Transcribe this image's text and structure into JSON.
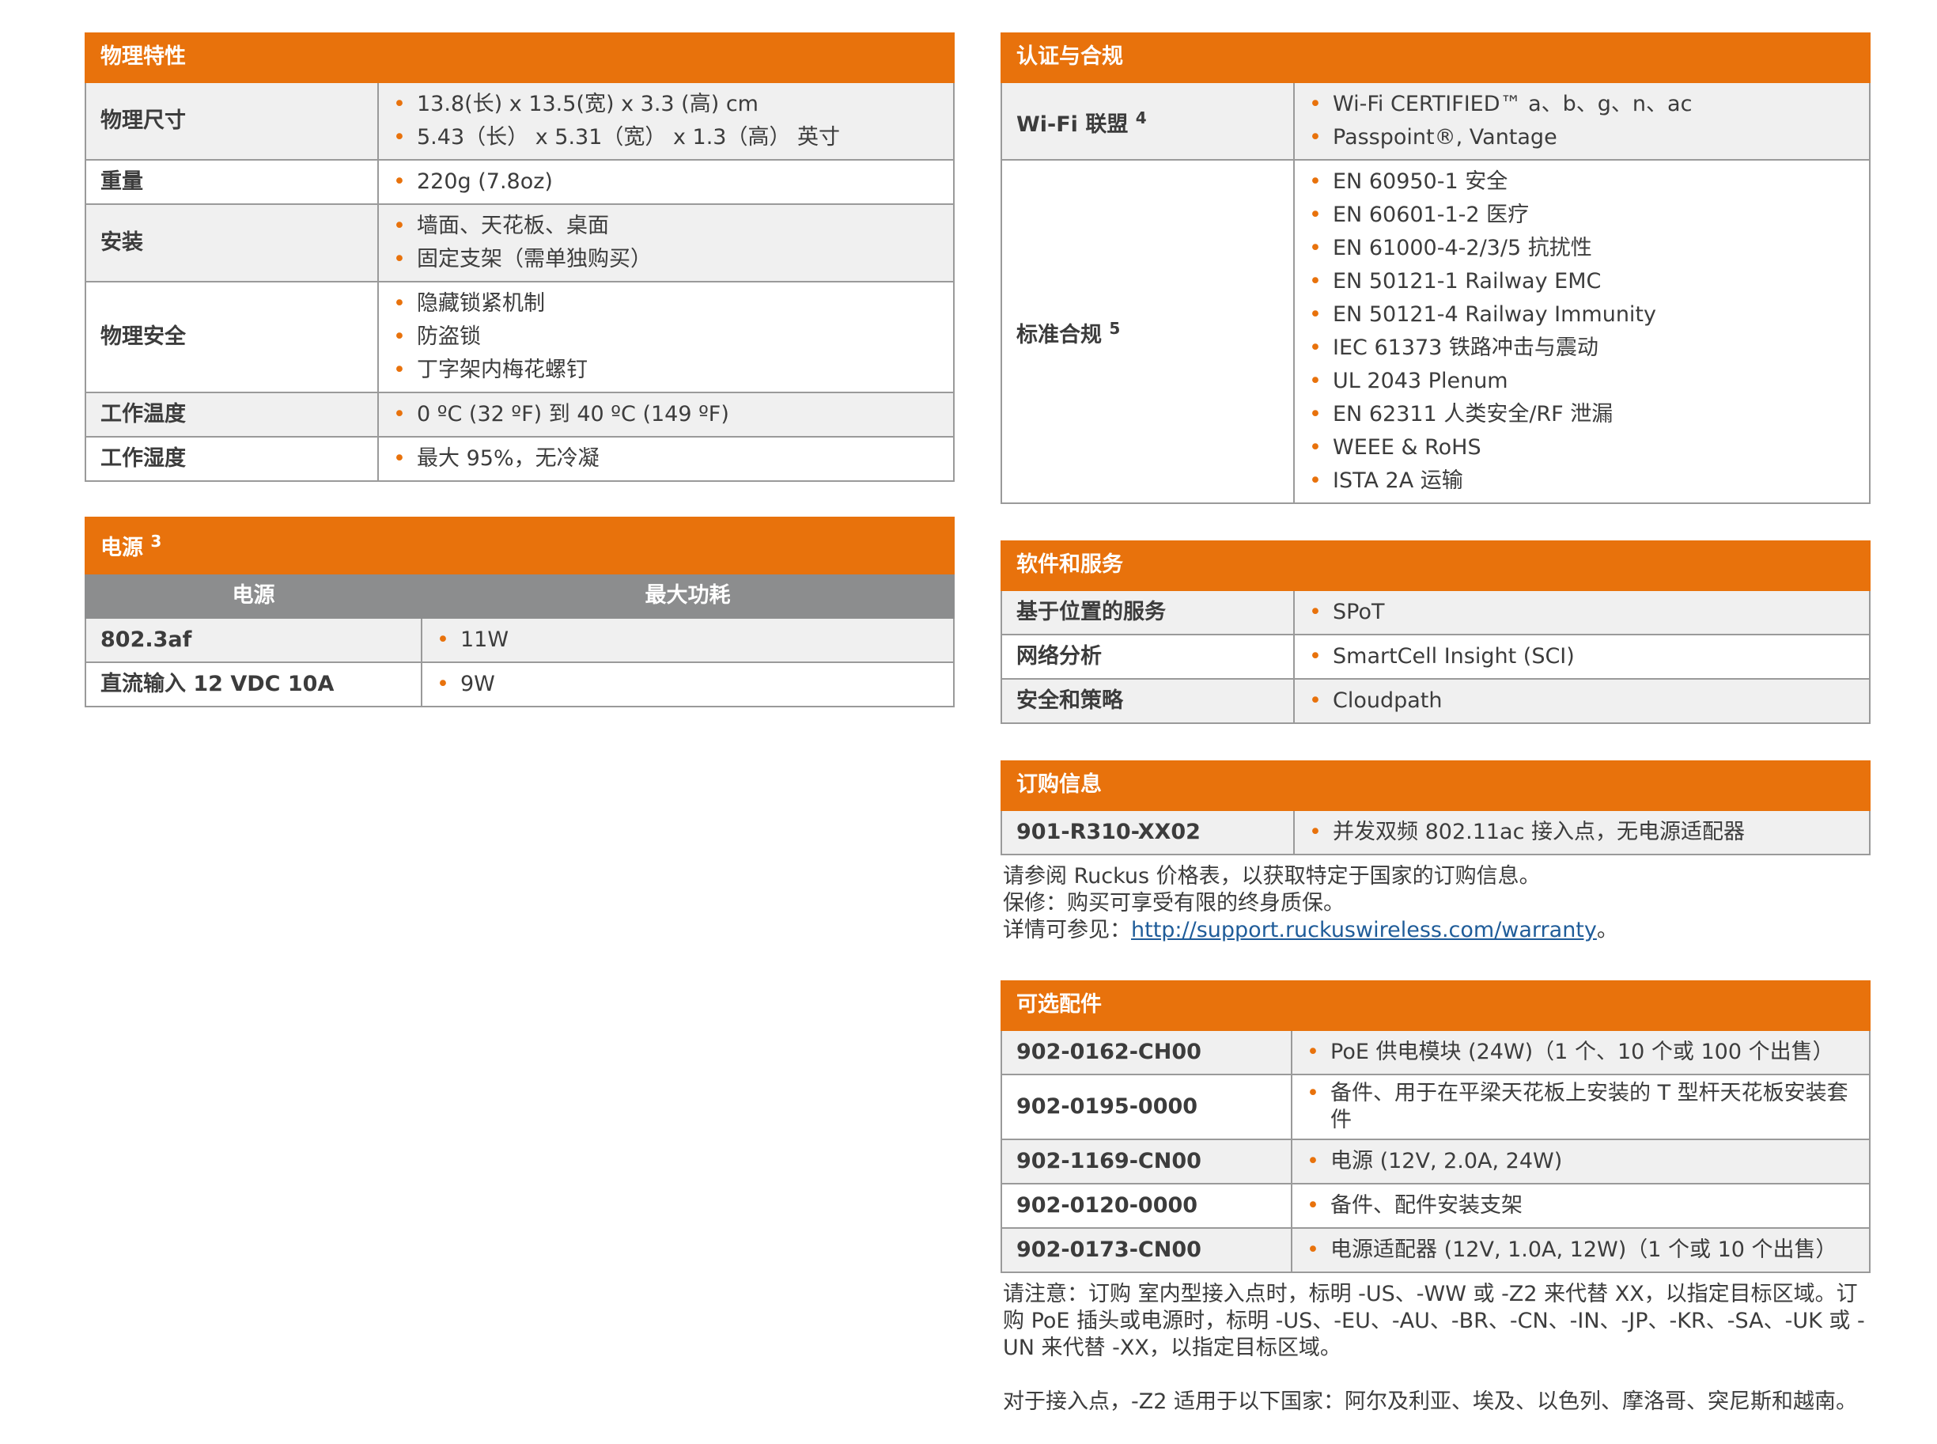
{
  "physical": {
    "title": "物理特性",
    "rows": [
      {
        "label": "物理尺寸",
        "items": [
          "13.8(长) x 13.5(宽) x 3.3 (高) cm",
          "5.43（长） x 5.31（宽） x 1.3（高） 英寸"
        ]
      },
      {
        "label": "重量",
        "items": [
          "220g (7.8oz)"
        ]
      },
      {
        "label": "安装",
        "items": [
          "墙面、天花板、桌面",
          "固定支架（需单独购买）"
        ]
      },
      {
        "label": "物理安全",
        "items": [
          "隐藏锁紧机制",
          "防盗锁",
          "丁字架内梅花螺钉"
        ]
      },
      {
        "label": "工作温度",
        "items": [
          "0 ºC (32 ºF) 到 40 ºC (149 ºF)"
        ]
      },
      {
        "label": "工作湿度",
        "items": [
          "最大 95%，无冷凝"
        ]
      }
    ]
  },
  "power": {
    "title": "电源",
    "title_sup": "3",
    "col1": "电源",
    "col2": "最大功耗",
    "rows": [
      {
        "label": "802.3af",
        "value": "11W"
      },
      {
        "label": "直流输入 12 VDC 10A",
        "value": "9W"
      }
    ]
  },
  "certification": {
    "title": "认证与合规",
    "wifi_label": "Wi-Fi 联盟",
    "wifi_sup": "4",
    "wifi_items": [
      "Wi-Fi CERTIFIED™ a、b、g、n、ac",
      "Passpoint®, Vantage"
    ],
    "std_label": "标准合规",
    "std_sup": "5",
    "std_items": [
      "EN 60950-1 安全",
      "EN 60601-1-2 医疗",
      "EN 61000-4-2/3/5 抗扰性",
      "EN 50121-1 Railway EMC",
      "EN 50121-4 Railway Immunity",
      "IEC 61373 铁路冲击与震动",
      "UL 2043 Plenum",
      "EN 62311 人类安全/RF 泄漏",
      "WEEE & RoHS",
      "ISTA 2A 运输"
    ]
  },
  "software": {
    "title": "软件和服务",
    "rows": [
      {
        "label": "基于位置的服务",
        "value": "SPoT"
      },
      {
        "label": "网络分析",
        "value": "SmartCell Insight (SCI)"
      },
      {
        "label": "安全和策略",
        "value": "Cloudpath"
      }
    ]
  },
  "ordering": {
    "title": "订购信息",
    "rows": [
      {
        "label": "901-R310-XX02",
        "value": "并发双频 802.11ac 接入点，无电源适配器"
      }
    ],
    "note1": "请参阅 Ruckus 价格表，以获取特定于国家的订购信息。",
    "note2": "保修：购买可享受有限的终身质保。",
    "note3_prefix": "详情可参见：",
    "note3_link": "http://support.ruckuswireless.com/warranty",
    "note3_suffix": "。"
  },
  "accessories": {
    "title": "可选配件",
    "rows": [
      {
        "label": "902-0162-CH00",
        "value": "PoE 供电模块 (24W)（1 个、10 个或 100 个出售）"
      },
      {
        "label": "902-0195-0000",
        "value": "备件、用于在平梁天花板上安装的 T 型杆天花板安装套件"
      },
      {
        "label": "902-1169-CN00",
        "value": "电源 (12V, 2.0A, 24W)"
      },
      {
        "label": "902-0120-0000",
        "value": "备件、配件安装支架"
      },
      {
        "label": "902-0173-CN00",
        "value": "电源适配器 (12V, 1.0A, 12W)（1 个或 10 个出售）"
      }
    ],
    "note1": "请注意：订购 室内型接入点时，标明 -US、-WW 或 -Z2 来代替 XX，以指定目标区域。订购 PoE 插头或电源时，标明 -US、-EU、-AU、-BR、-CN、-IN、-JP、-KR、-SA、-UK 或 -UN 来代替 -XX，以指定目标区域。",
    "note2": "对于接入点，-Z2 适用于以下国家：阿尔及利亚、埃及、以色列、摩洛哥、突尼斯和越南。"
  }
}
